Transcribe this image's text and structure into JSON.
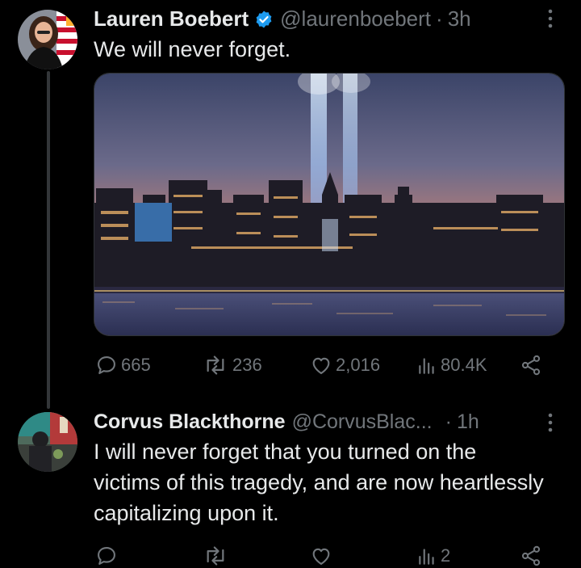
{
  "tweet": {
    "author_name": "Lauren Boebert",
    "handle": "@laurenboebert",
    "time": "3h",
    "text": "We will never forget.",
    "media_icon": "city-skyline-photo",
    "stats": {
      "replies": "665",
      "retweets": "236",
      "likes": "2,016",
      "views": "80.4K"
    }
  },
  "reply": {
    "author_name": "Corvus Blackthorne",
    "handle": "@CorvusBlac...",
    "time": "1h",
    "text": "I will never forget that you turned on the victims of this tragedy, and are now heartlessly capitalizing upon it.",
    "stats": {
      "views": "2"
    }
  },
  "colors": {
    "background": "#000000",
    "text_primary": "#e7e9ea",
    "text_secondary": "#71767b",
    "verified": "#1d9bf0"
  },
  "icons": [
    "verified-badge-icon",
    "more-icon",
    "reply-icon",
    "retweet-icon",
    "like-icon",
    "views-icon",
    "share-icon"
  ]
}
